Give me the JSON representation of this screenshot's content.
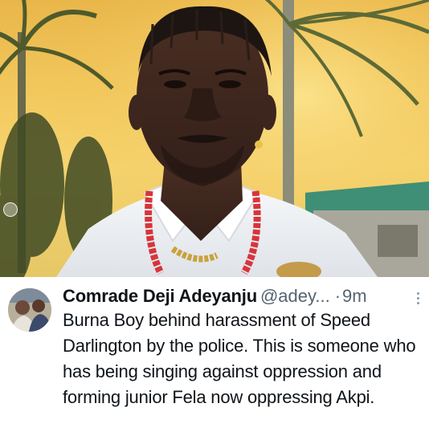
{
  "post": {
    "image": {
      "icon": "carousel-indicator-icon"
    },
    "author": {
      "display_name": "Comrade Deji Adeyanju",
      "handle": "@adey...",
      "separator": "·",
      "timestamp": "9m"
    },
    "more_icon": "more-vertical-icon",
    "text": "Burna Boy behind harassment of Speed Darlington by the police. This is someone who has being singing against oppression and forming junior Fela now oppressing Akpi."
  }
}
